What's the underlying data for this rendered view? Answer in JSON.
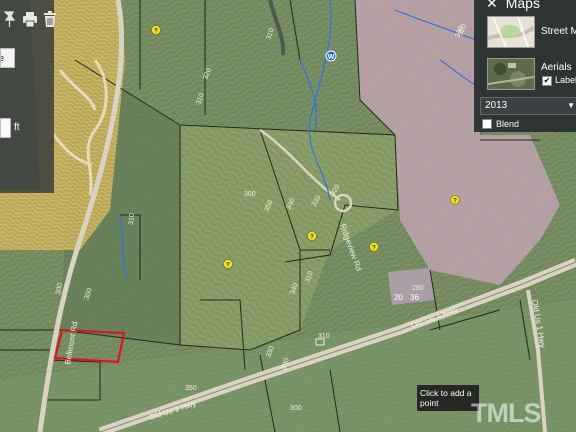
{
  "maps_panel": {
    "title": "Maps",
    "layers": [
      {
        "label": "Street Ma"
      },
      {
        "label": "Aerials"
      }
    ],
    "labels_checkbox": {
      "label": "Label",
      "checked": true,
      "mark": "✔"
    },
    "year_select": {
      "value": "2013"
    },
    "blend_checkbox": {
      "label": "Blend",
      "checked": false
    }
  },
  "tool_panel": {
    "unit_select": "ine",
    "unit_label": "ft",
    "icons": [
      "pin-icon",
      "print-icon",
      "trash-icon"
    ]
  },
  "tooltip": {
    "text": "Click to add a point"
  },
  "watermark": "TMLS",
  "map": {
    "road_labels": [
      "Old Us 1 Hwy",
      "Old Us 1 Hwy",
      "Ridgeview Rd",
      "Bellmont Rd",
      "Old Us 1 Hwy"
    ],
    "contour_labels": [
      "330",
      "320",
      "310",
      "300",
      "350",
      "340",
      "330",
      "320",
      "310",
      "340",
      "330",
      "350",
      "310",
      "300",
      "300",
      "290",
      "300",
      "280",
      "310",
      "320",
      "310"
    ],
    "parcel_labels": [
      "20",
      "36"
    ],
    "poi_marker": "?",
    "water_marker": "W"
  },
  "colors": {
    "aerial_green": "#6f8a63",
    "selected_parcel": "#e0141e",
    "parcel_lines": "#1e2a1e",
    "contours": "#c9a64a",
    "streams": "#2f72d8",
    "marker_yellow": "#f0e020"
  }
}
